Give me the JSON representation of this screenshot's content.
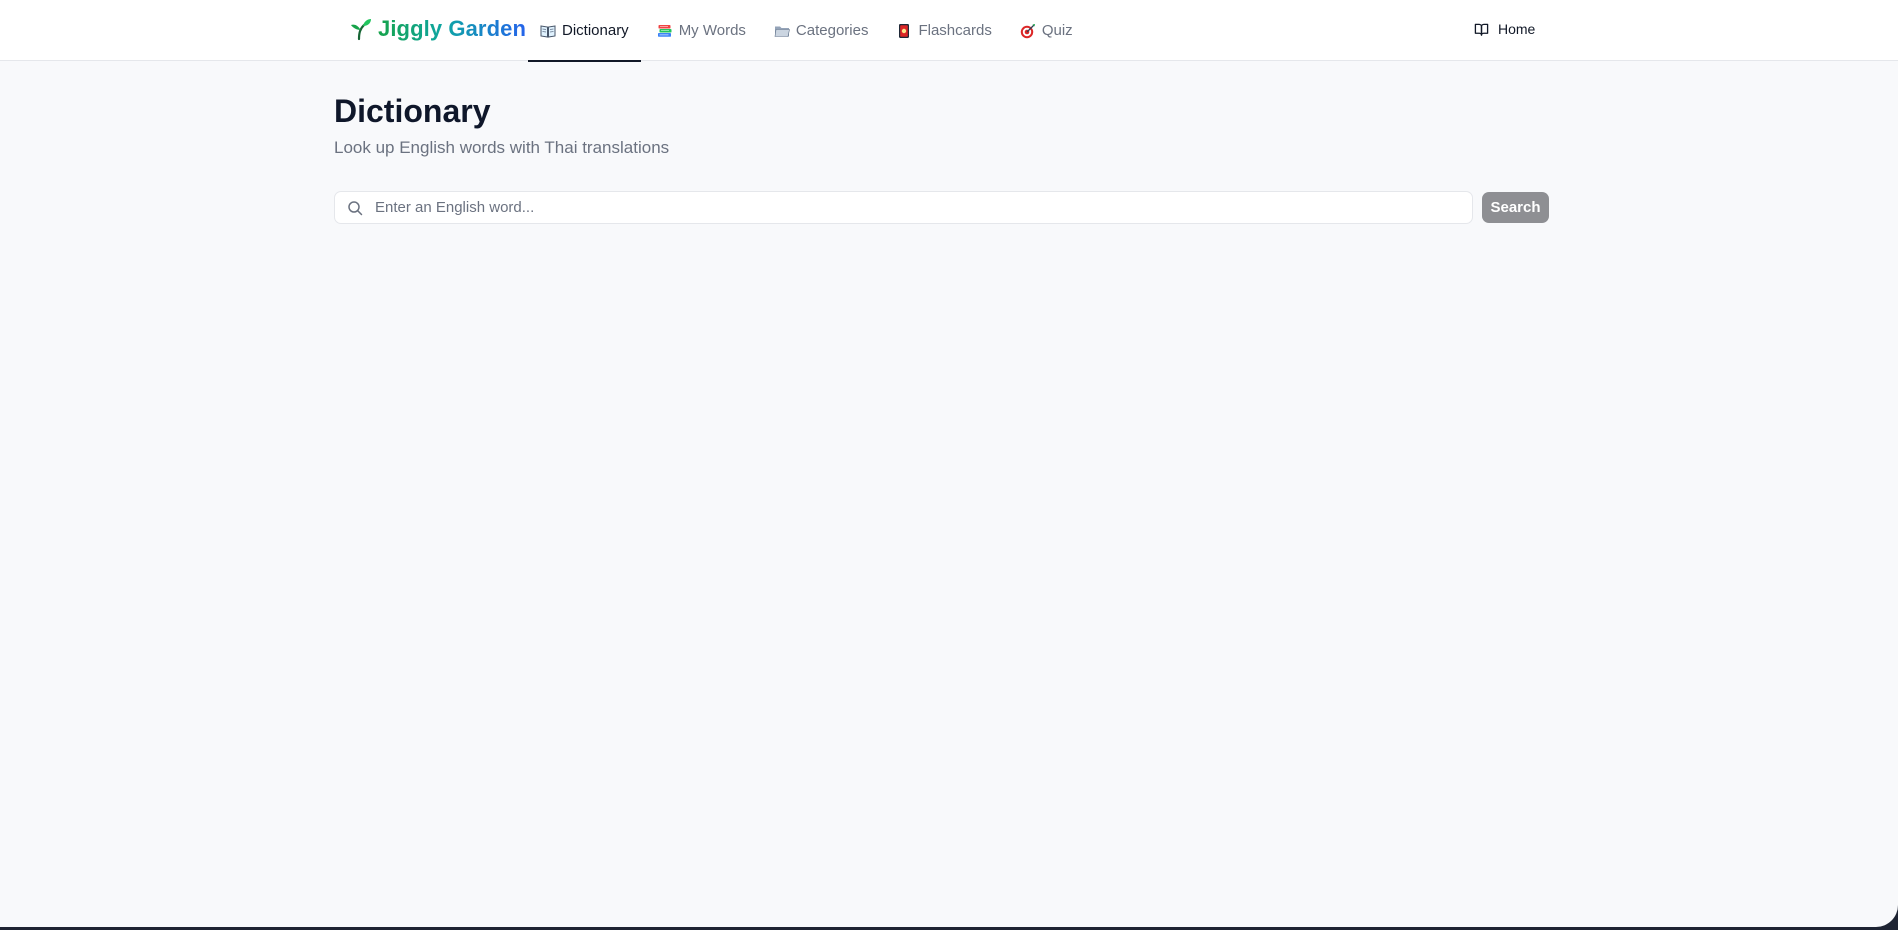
{
  "app": {
    "name": "Jiggly Garden",
    "icon": "seedling-icon",
    "brand_gradient": [
      "#16a34a",
      "#0ea5a5",
      "#2563eb"
    ]
  },
  "nav": {
    "items": [
      {
        "label": "Dictionary",
        "icon": "open-book-icon",
        "active": true
      },
      {
        "label": "My Words",
        "icon": "books-stack-icon",
        "active": false
      },
      {
        "label": "Categories",
        "icon": "folder-icon",
        "active": false
      },
      {
        "label": "Flashcards",
        "icon": "flashcard-icon",
        "active": false
      },
      {
        "label": "Quiz",
        "icon": "target-icon",
        "active": false
      }
    ],
    "home": {
      "label": "Home",
      "icon": "book-outline-icon"
    }
  },
  "page": {
    "title": "Dictionary",
    "subtitle": "Look up English words with Thai translations"
  },
  "search": {
    "placeholder": "Enter an English word...",
    "value": "",
    "button_label": "Search",
    "button_color": "#8e8f93"
  }
}
